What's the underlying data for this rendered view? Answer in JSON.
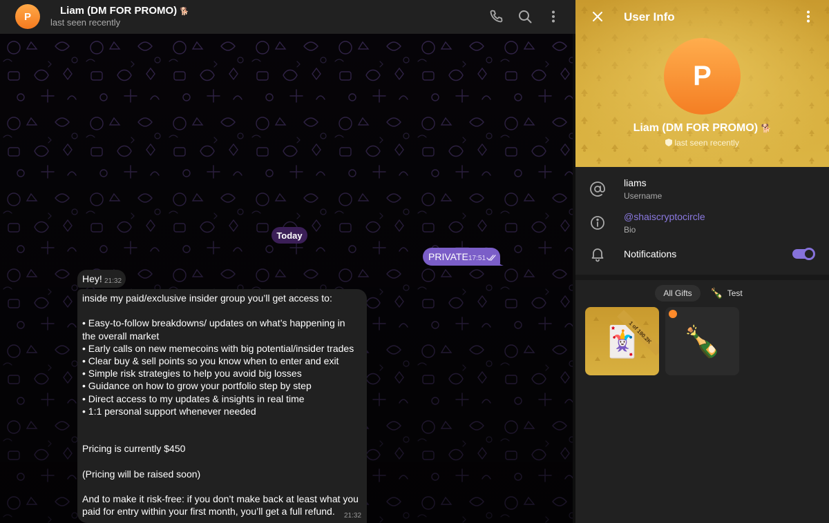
{
  "chat": {
    "header": {
      "avatar_letter": "P",
      "name": "Liam (DM FOR PROMO)",
      "status": "last seen recently",
      "icons": [
        "phone-icon",
        "search-icon",
        "more-vertical-icon"
      ]
    },
    "date_separator": "Today",
    "messages": {
      "outgoing": {
        "text": "PRIVATE",
        "time": "17:51",
        "read": true
      },
      "greeting": {
        "text": "Hey!",
        "time": "21:32"
      },
      "promo": {
        "time": "21:32",
        "line_intro": "inside my paid/exclusive insider group you’ll get access to:",
        "bullets": [
          " • Easy-to-follow breakdowns/ updates on what’s happening in",
          "the overall market",
          " • Early calls on new memecoins with big potential/insider trades",
          " • Clear buy & sell points so you know when to enter and exit",
          " • Simple risk strategies to help you avoid big losses",
          " • Guidance on how to grow your portfolio step by step",
          " • Direct access to my updates & insights in real time",
          " • 1:1 personal support whenever needed"
        ],
        "pricing": "Pricing is currently $450",
        "pricing_note": "(Pricing will be raised soon)",
        "refund_1": "And to make it risk-free: if you don’t make back at least what you",
        "refund_2": "paid for entry within your first month, you’ll get a full refund."
      }
    }
  },
  "user_info": {
    "title": "User Info",
    "avatar_letter": "P",
    "name": "Liam (DM FOR PROMO)",
    "status": "last seen recently",
    "username": {
      "value": "liams",
      "label": "Username"
    },
    "bio": {
      "value": "@shaiscryptocircle",
      "label": "Bio"
    },
    "notifications": {
      "label": "Notifications",
      "enabled": true
    },
    "gift_tabs": [
      {
        "label": "All Gifts",
        "active": true
      },
      {
        "label": "Test",
        "emoji": "🍾",
        "active": false
      }
    ],
    "gifts": [
      {
        "ribbon": "1 of 190.2K",
        "emoji": "🃏"
      },
      {
        "emoji": "🍾"
      }
    ]
  },
  "colors": {
    "accent": "#8672db",
    "outgoing_bubble": "#7b5ec8",
    "incoming_bubble": "#212121",
    "hero_gold": "#d6ad3c",
    "avatar_orange": "#f57a1f"
  }
}
